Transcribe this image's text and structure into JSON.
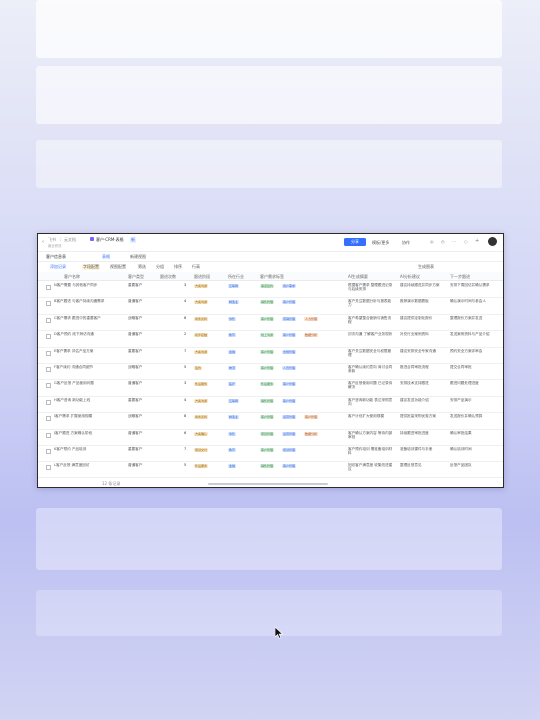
{
  "window": {
    "breadcrumb_home": "飞书",
    "breadcrumb_sep": "/",
    "breadcrumb_folder": "云文档",
    "doc_title": "客户·CRM·表格",
    "doc_badge": "新",
    "doc_subtitle": "最近修改",
    "share_button": "分享",
    "template_button": "模板/更多",
    "link_button": "协作"
  },
  "tabs": [
    {
      "label": "客户信息表"
    },
    {
      "label": "表格"
    },
    {
      "label": "新建视图"
    }
  ],
  "toolbar": {
    "items": [
      {
        "label": "添加记录"
      },
      {
        "label": "字段配置"
      },
      {
        "label": "视图配置"
      },
      {
        "label": "筛选"
      },
      {
        "label": "分组"
      },
      {
        "label": "排序"
      },
      {
        "label": "行高"
      }
    ],
    "right_label": "生成图表"
  },
  "columns": [
    "客户名称",
    "客户类型",
    "跟进次数",
    "跟进阶段",
    "所在行业",
    "客户需求标签",
    "AI生成摘要",
    "AI分析建议",
    "下一步跟进"
  ],
  "rows": [
    {
      "name": "N客户需要 与其他客户同步",
      "type": "重要客户",
      "n": "3",
      "stage": "方案沟通",
      "ind": "互联网",
      "t1": "渠道签约",
      "t2": "用户需求",
      "t3": "",
      "sum": "根据客户需求 整理跟进记录与后续安排",
      "adv": "建议持续跟进并同步方案",
      "next": "安排下周回访并确认需求"
    },
    {
      "name": "B客户跟进 与客户持续沟通需求",
      "type": "普通客户",
      "n": "4",
      "stage": "方案沟通",
      "ind": "制造业",
      "t1": "销售管理",
      "t2": "客户管理",
      "t3": "",
      "sum": "客户关注数据分析与报表能力",
      "adv": "推荐演示数据看板",
      "next": "确认演示时间与参会人"
    },
    {
      "name": "C客户需求 跟进中的重要客户",
      "type": "战略客户",
      "n": "6",
      "stage": "商务谈判",
      "ind": "零售",
      "t1": "客户管理",
      "t2": "营销管理",
      "t3": "人力管理",
      "sum": "客户希望整合营销与销售流程",
      "adv": "建议提供定制化报价",
      "next": "整理报价方案并发送"
    },
    {
      "name": "D客户预约 线下拜访沟通",
      "type": "普通客户",
      "n": "2",
      "stage": "初步接触",
      "ind": "教育",
      "t1": "线上沟通",
      "t2": "客户管理",
      "t3": "数据分析",
      "sum": "初次沟通 了解客户业务现状",
      "adv": "补充行业案例资料",
      "next": "发送案例资料与产品介绍"
    },
    {
      "name": "E客户需求 评估产品方案",
      "type": "重要客户",
      "n": "7",
      "stage": "方案沟通",
      "ind": "金融",
      "t1": "客户管理",
      "t2": "合规管理",
      "t3": "",
      "sum": "客户关注数据安全与权限管理",
      "adv": "建议安排安全专家沟通",
      "next": "预约安全方案评审会"
    },
    {
      "name": "F客户续约 沟通合同细节",
      "type": "战略客户",
      "n": "5",
      "stage": "签约",
      "ind": "物流",
      "t1": "客户管理",
      "t2": "人员管理",
      "t3": "",
      "sum": "客户确认续约意向 商讨合同条款",
      "adv": "推进合同审批流程",
      "next": "提交合同审批"
    },
    {
      "name": "G客户反馈 产品使用问题",
      "type": "普通客户",
      "n": "3",
      "stage": "售后服务",
      "ind": "医疗",
      "t1": "售后服务",
      "t2": "客户管理",
      "t3": "",
      "sum": "客户反馈使用问题 已记录待解决",
      "adv": "安排技术支持跟进",
      "next": "跟进问题处理进度"
    },
    {
      "name": "H客户咨询 新功能上线",
      "type": "重要客户",
      "n": "4",
      "stage": "方案沟通",
      "ind": "互联网",
      "t1": "销售管理",
      "t2": "客户管理",
      "t3": "",
      "sum": "客户咨询新功能 表达采购意向",
      "adv": "建议发送功能介绍",
      "next": "安排产品演示"
    },
    {
      "name": "I客户需求 扩展使用规模",
      "type": "战略客户",
      "n": "8",
      "stage": "商务谈判",
      "ind": "制造业",
      "t1": "客户管理",
      "t2": "运营管理",
      "t3": "客户管理",
      "sum": "客户计划扩大使用规模",
      "adv": "提供批量采购优惠方案",
      "next": "发送报价并确认预算"
    },
    {
      "name": "J客户跟进 方案确认阶段",
      "type": "普通客户",
      "n": "6",
      "stage": "方案确认",
      "ind": "零售",
      "t1": "项目管理",
      "t2": "运营管理",
      "t3": "数据分析",
      "sum": "客户确认方案内容 等待内部审批",
      "adv": "持续跟进审批进度",
      "next": "确认审批结果"
    },
    {
      "name": "K客户预约 产品培训",
      "type": "重要客户",
      "n": "7",
      "stage": "培训交付",
      "ind": "教育",
      "t1": "客户管理",
      "t2": "培训管理",
      "t3": "",
      "sum": "客户预约培训 需准备培训材料",
      "adv": "准备培训课件与手册",
      "next": "确认培训时间"
    },
    {
      "name": "L客户反馈 满意度回访",
      "type": "普通客户",
      "n": "5",
      "stage": "售后服务",
      "ind": "金融",
      "t1": "销售管理",
      "t2": "客户管理",
      "t3": "",
      "sum": "回访客户满意度 收集改进建议",
      "adv": "整理反馈意见",
      "next": "反馈产品团队"
    }
  ],
  "footer": {
    "count_label": "12 条记录"
  },
  "colors": {
    "accent": "#3370ff",
    "stage_tag": "#fde9c7",
    "ind_tag": "#dce9ff",
    "t_green": "#d9f2df",
    "t_blue": "#dce9ff",
    "t_orange": "#fde4cf"
  }
}
